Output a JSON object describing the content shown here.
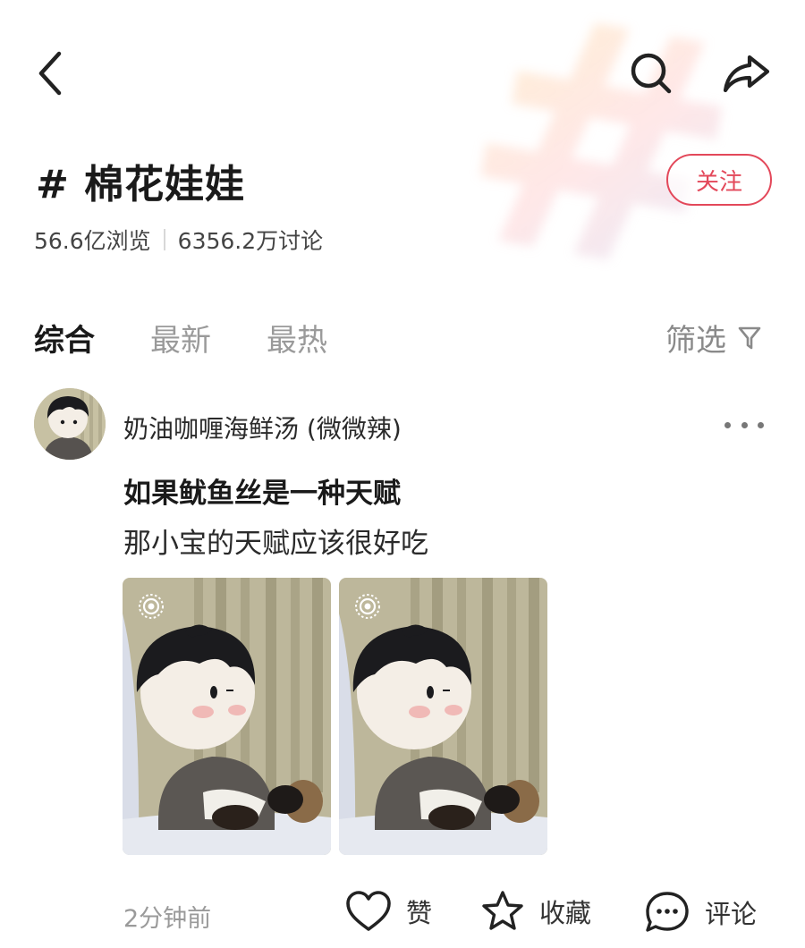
{
  "header": {
    "back_icon": "chevron-left-icon",
    "search_icon": "search-icon",
    "share_icon": "share-arrow-icon"
  },
  "topic": {
    "title": "# 棉花娃娃",
    "follow_label": "关注",
    "views": "56.6亿浏览",
    "discussions": "6356.2万讨论"
  },
  "tabs": [
    {
      "label": "综合",
      "active": true
    },
    {
      "label": "最新",
      "active": false
    },
    {
      "label": "最热",
      "active": false
    }
  ],
  "filter": {
    "label": "筛选",
    "icon": "filter-funnel-icon"
  },
  "post": {
    "author": "奶油咖喱海鲜汤 (微微辣)",
    "title": "如果鱿鱼丝是一种天赋",
    "body": "那小宝的天赋应该很好吃",
    "time": "2分钟前",
    "actions": {
      "like": "赞",
      "collect": "收藏",
      "comment": "评论"
    }
  },
  "colors": {
    "accent": "#e3485a",
    "text_primary": "#1a1a1a",
    "text_muted": "#9a9a9a"
  }
}
